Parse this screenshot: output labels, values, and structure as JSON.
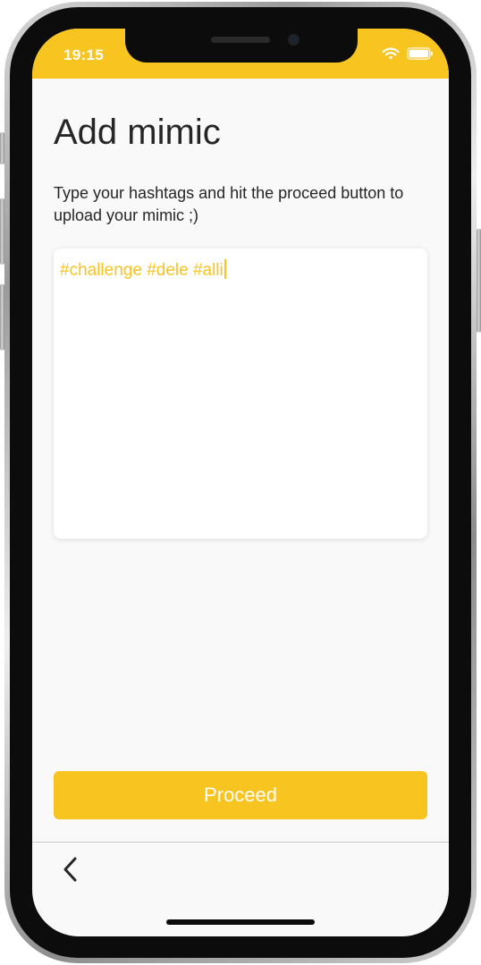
{
  "status_bar": {
    "time": "19:15",
    "wifi_icon": "wifi-icon",
    "battery_icon": "battery-icon",
    "color": "#f8c420"
  },
  "page": {
    "title": "Add mimic",
    "description": "Type your hashtags and hit the proceed button to upload your mimic ;)"
  },
  "hashtag_input": {
    "value": "#challenge #dele #alli"
  },
  "actions": {
    "proceed_label": "Proceed"
  },
  "navigation": {
    "back_icon": "chevron-left-icon"
  },
  "colors": {
    "accent": "#f8c420",
    "text": "#262626",
    "background": "#f9f9f9"
  }
}
